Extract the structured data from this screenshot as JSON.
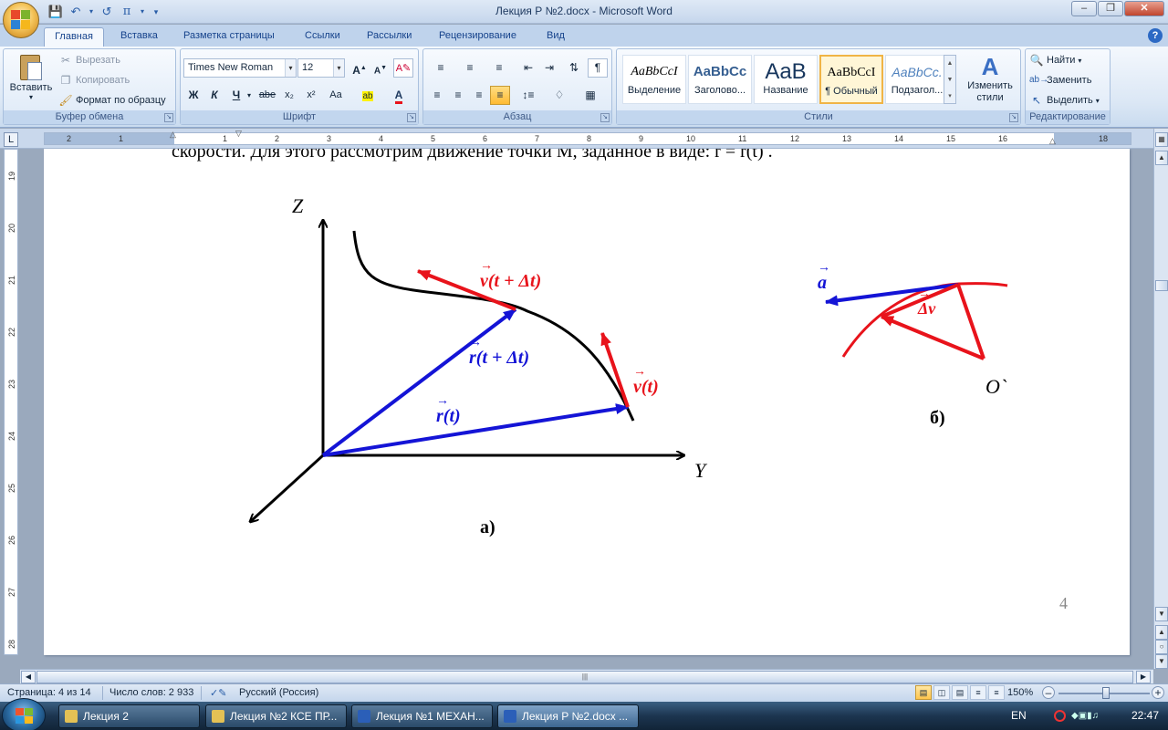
{
  "window": {
    "title": "Лекция Р №2.docx - Microsoft Word"
  },
  "ribbon_tabs": [
    "Главная",
    "Вставка",
    "Разметка страницы",
    "Ссылки",
    "Рассылки",
    "Рецензирование",
    "Вид"
  ],
  "clipboard": {
    "paste": "Вставить",
    "cut": "Вырезать",
    "copy": "Копировать",
    "format_painter": "Формат по образцу",
    "group_label": "Буфер обмена"
  },
  "font": {
    "family": "Times New Roman",
    "size": "12",
    "group_label": "Шрифт",
    "bold": "Ж",
    "italic": "К",
    "underline": "Ч",
    "strike": "abe",
    "subscript": "x₂",
    "superscript": "x²",
    "case": "Aa"
  },
  "paragraph": {
    "group_label": "Абзац"
  },
  "styles": {
    "group_label": "Стили",
    "items": [
      {
        "preview": "AaBbCcI",
        "name": "Выделение"
      },
      {
        "preview": "AaBbCc",
        "name": "Заголово..."
      },
      {
        "preview": "AaB",
        "name": "Название"
      },
      {
        "preview": "AaBbCcI",
        "name": "¶ Обычный"
      },
      {
        "preview": "AaBbCc.",
        "name": "Подзагол..."
      }
    ],
    "change_styles": "Изменить стили"
  },
  "editing": {
    "group_label": "Редактирование",
    "find": "Найти",
    "replace": "Заменить",
    "select": "Выделить"
  },
  "ruler": {
    "h_numbers": [
      "2",
      "1",
      "1",
      "2",
      "3",
      "4",
      "5",
      "6",
      "7",
      "8",
      "9",
      "10",
      "11",
      "12",
      "13",
      "14",
      "15",
      "16",
      "18"
    ],
    "v_numbers": [
      "19",
      "20",
      "21",
      "22",
      "23",
      "24",
      "25",
      "26",
      "27",
      "28"
    ]
  },
  "document": {
    "cut_text": "скорости. Для этого рассмотрим движение точки М, заданное в виде: r = r(t) .",
    "fig_a": {
      "label": "а)",
      "z_axis": "Z",
      "y_axis": "Y",
      "v_t_dt": "v(t + Δt)",
      "r_t_dt": "r(t + Δt)",
      "v_t": "v(t)",
      "r_t": "r(t)"
    },
    "fig_b": {
      "label": "б)",
      "a": "a",
      "dv": "Δv",
      "origin": "O`"
    },
    "page_number": "4"
  },
  "status": {
    "page": "Страница: 4 из 14",
    "words": "Число слов: 2 933",
    "language": "Русский (Россия)",
    "zoom": "150%"
  },
  "taskbar": {
    "items": [
      {
        "label": "Лекция 2"
      },
      {
        "label": "Лекция №2 КСЕ ПР..."
      },
      {
        "label": "Лекция №1 МЕХАН..."
      },
      {
        "label": "Лекция Р №2.docx ..."
      }
    ],
    "lang": "EN",
    "clock": "22:47"
  },
  "colors": {
    "vector_red": "#e8131b",
    "vector_blue": "#1414d6",
    "ribbon_bg": "#dbe7f5"
  }
}
